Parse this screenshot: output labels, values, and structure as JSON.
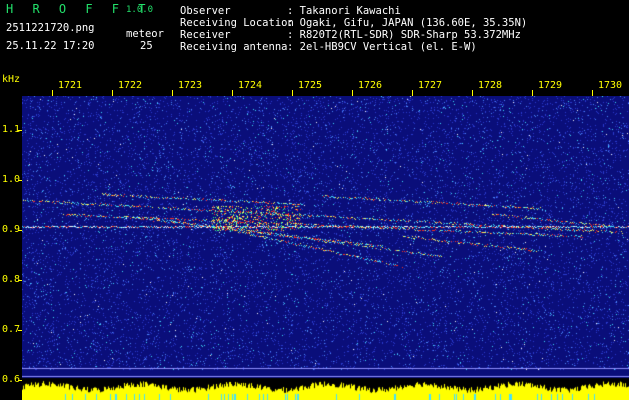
{
  "header": {
    "app_title": "H R O F F T",
    "version": "1.0.0",
    "filename": "2511221720.png",
    "meteor_label": "meteor",
    "datetime": "25.11.22 17:20",
    "meteor_count": "25",
    "fields": [
      {
        "label": "Observer",
        "value": ": Takanori Kawachi"
      },
      {
        "label": "Receiving Location",
        "value": ": Ogaki, Gifu, JAPAN (136.60E, 35.35N)"
      },
      {
        "label": "Receiver",
        "value": ": R820T2(RTL-SDR) SDR-Sharp 53.372MHz"
      },
      {
        "label": "Receiving antenna",
        "value": ": 2el-HB9CV Vertical (el. E-W)"
      }
    ]
  },
  "axis": {
    "unit": "kHz",
    "y_ticks": [
      "1.1",
      "1.0",
      "0.9",
      "0.8",
      "0.7",
      "0.6"
    ],
    "time_ticks": [
      "1721",
      "1722",
      "1723",
      "1724",
      "1725",
      "1726",
      "1727",
      "1728",
      "1729",
      "1730"
    ]
  },
  "colors": {
    "background": "#0a0e7a",
    "label_yellow": "#ffff00",
    "title_green": "#22e06a",
    "trace_red": "#ff3020",
    "trace_cyan": "#40e0ff",
    "level_yellow": "#ffff00"
  }
}
